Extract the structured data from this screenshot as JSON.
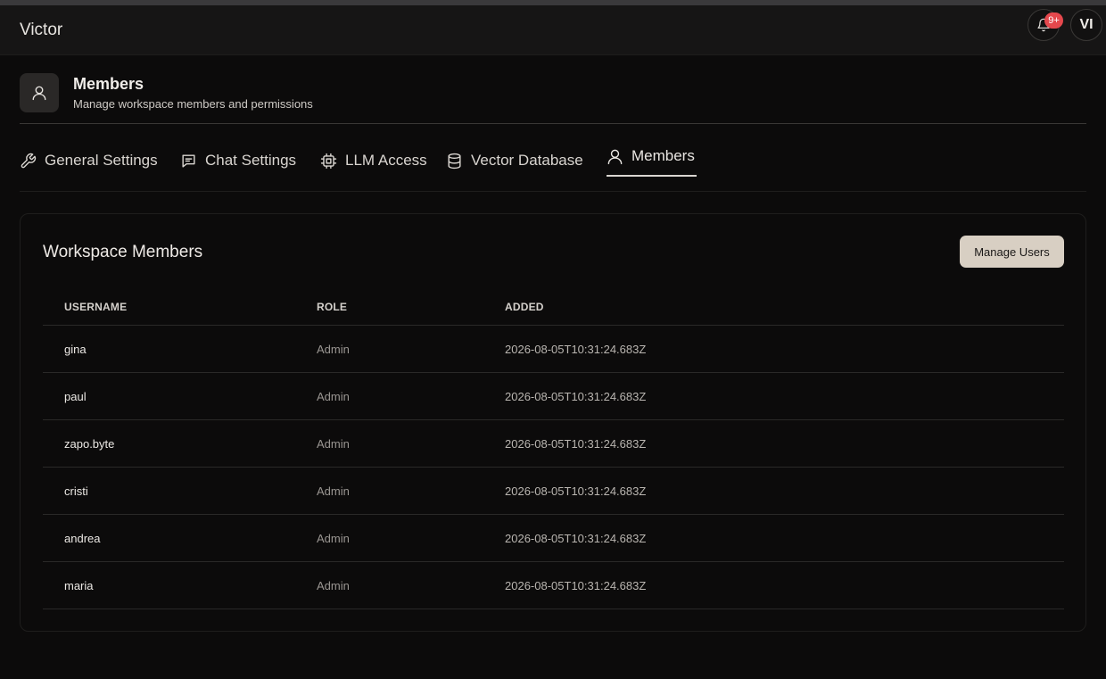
{
  "app": {
    "title": "Victor"
  },
  "header": {
    "notifications_badge": "9+",
    "avatar_initials": "VI"
  },
  "page": {
    "title": "Members",
    "subtitle": "Manage workspace members and permissions"
  },
  "tabs": [
    {
      "label": "General Settings",
      "icon": "wrench-icon",
      "active": false
    },
    {
      "label": "Chat Settings",
      "icon": "chat-icon",
      "active": false
    },
    {
      "label": "LLM Access",
      "icon": "cpu-icon",
      "active": false
    },
    {
      "label": "Vector Database",
      "icon": "database-icon",
      "active": false
    },
    {
      "label": "Members",
      "icon": "user-icon",
      "active": true
    }
  ],
  "members_card": {
    "title": "Workspace Members",
    "manage_button": "Manage Users",
    "columns": [
      "USERNAME",
      "ROLE",
      "ADDED"
    ],
    "rows": [
      {
        "username": "gina",
        "role": "Admin",
        "added": "2026-08-05T10:31:24.683Z"
      },
      {
        "username": "paul",
        "role": "Admin",
        "added": "2026-08-05T10:31:24.683Z"
      },
      {
        "username": "zapo.byte",
        "role": "Admin",
        "added": "2026-08-05T10:31:24.683Z"
      },
      {
        "username": "cristi",
        "role": "Admin",
        "added": "2026-08-05T10:31:24.683Z"
      },
      {
        "username": "andrea",
        "role": "Admin",
        "added": "2026-08-05T10:31:24.683Z"
      },
      {
        "username": "maria",
        "role": "Admin",
        "added": "2026-08-05T10:31:24.683Z"
      }
    ]
  },
  "colors": {
    "background": "#0c0b0b",
    "header": "#161515",
    "accent_button": "#d8cfc3",
    "badge": "#e5484d"
  }
}
